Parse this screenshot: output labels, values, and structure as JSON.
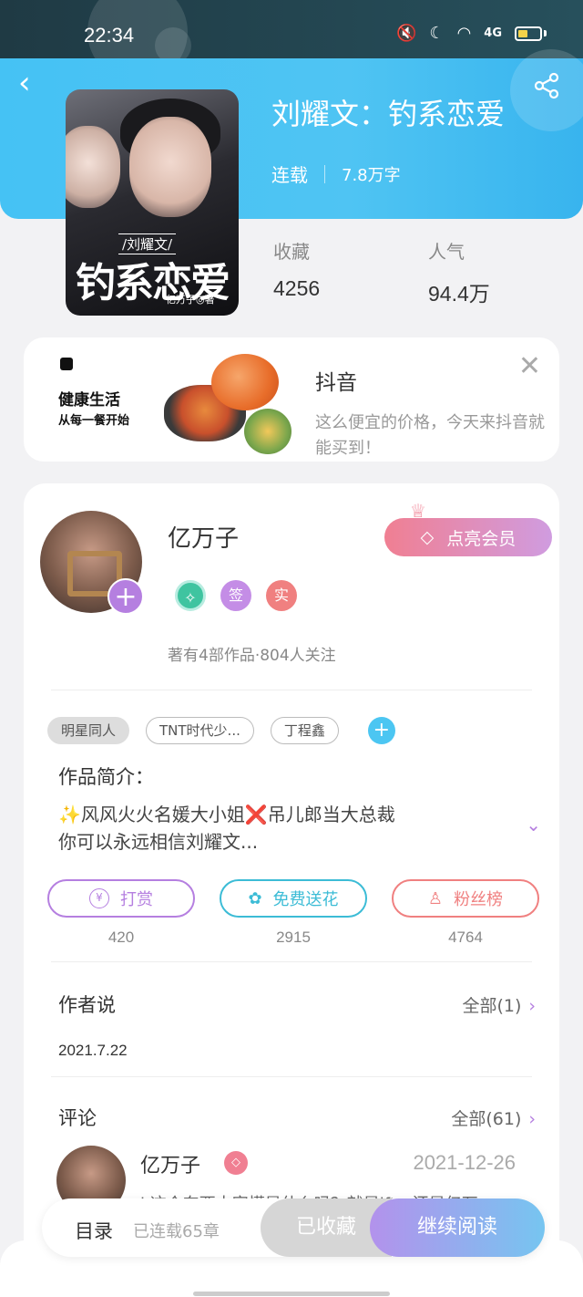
{
  "status_bar": {
    "time": "22:34",
    "network": "4G"
  },
  "header": {
    "title": "刘耀文：钓系恋爱",
    "status": "连载",
    "word_count": "7.8万字",
    "stats": [
      {
        "label": "收藏",
        "value": "4256"
      },
      {
        "label": "人气",
        "value": "94.4万"
      }
    ],
    "cover": {
      "small_title": "/刘耀文/",
      "big_title": "钓系恋爱",
      "author": "亿万子◎著"
    }
  },
  "ad": {
    "name": "抖音",
    "desc_line1": "这么便宜的价格，今天来抖音就",
    "desc_line2": "能买到！",
    "image_line1": "健康生活",
    "image_line2": "从每一餐开始",
    "close": "✕"
  },
  "author": {
    "name": "亿万子",
    "vip_label": "点亮会员",
    "badge_sign": "签",
    "badge_real": "实",
    "info": "著有4部作品·804人关注",
    "add": "+"
  },
  "tags": [
    "明星同人",
    "TNT时代少...",
    "丁程鑫"
  ],
  "intro": {
    "title": "作品简介：",
    "line1": "✨风风火火名媛大小姐❌吊儿郎当大总裁",
    "line2": "你可以永远相信刘耀文..."
  },
  "actions": [
    {
      "label": "打赏",
      "count": "420",
      "icon": "¥"
    },
    {
      "label": "免费送花",
      "count": "2915",
      "icon": "✿"
    },
    {
      "label": "粉丝榜",
      "count": "4764",
      "icon": "♙"
    }
  ],
  "author_says": {
    "title": "作者说",
    "more": "全部(1)",
    "date": "2021.7.22"
  },
  "comments": {
    "title": "评论",
    "more": "全部(61)",
    "items": [
      {
        "name": "亿万子",
        "date": "2021-12-26",
        "text": "l 这个东西大家懂是什么吗？就是lft，还是亿万"
      }
    ]
  },
  "bottom_bar": {
    "toc": "目录",
    "chapters": "已连载65章",
    "fav": "已收藏",
    "read": "继续阅读"
  },
  "colors": {
    "header": "#45c2f4",
    "accent": "#b57fe0",
    "vip": "#f07f92"
  }
}
